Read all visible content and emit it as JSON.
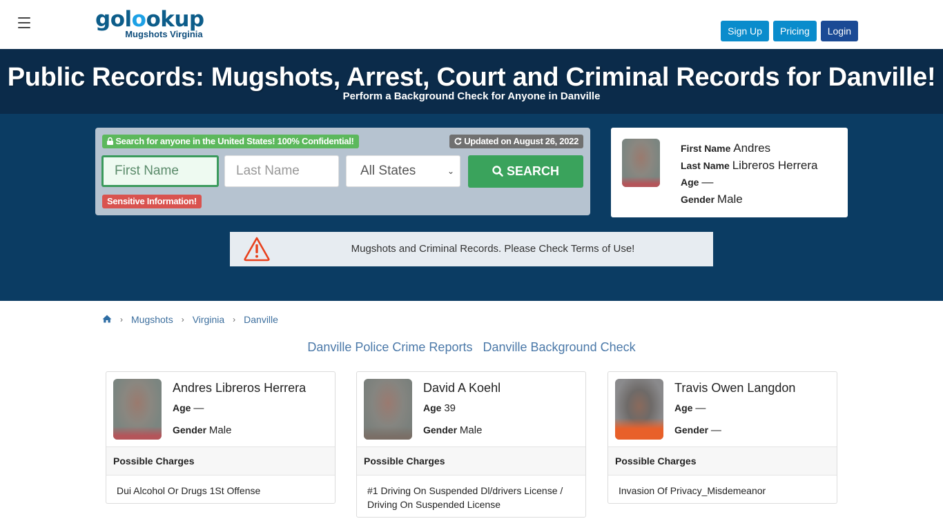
{
  "header": {
    "menu_icon": "hamburger-icon",
    "logo": {
      "brand_part1": "gol",
      "brand_accent": "o",
      "brand_part2": "okup",
      "subtitle": "Mugshots Virginia"
    },
    "buttons": {
      "signup": "Sign Up",
      "pricing": "Pricing",
      "login": "Login"
    }
  },
  "hero": {
    "title": "Public Records: Mugshots, Arrest, Court and Criminal Records for Danville!",
    "subtitle": "Perform a Background Check for Anyone in Danville"
  },
  "search": {
    "confidential_badge": "Search for anyone in the United States! 100% Confidential!",
    "confidential_icon": "lock-icon",
    "updated_badge": "Updated on August 26, 2022",
    "updated_icon": "refresh-icon",
    "first_name_placeholder": "First Name",
    "last_name_placeholder": "Last Name",
    "state_selected": "All States",
    "search_button": "SEARCH",
    "search_icon": "search-icon",
    "sensitive_badge": "Sensitive Information!"
  },
  "profile": {
    "first_name_label": "First Name",
    "first_name": "Andres",
    "last_name_label": "Last Name",
    "last_name": "Libreros Herrera",
    "age_label": "Age",
    "age": "—",
    "gender_label": "Gender",
    "gender": "Male"
  },
  "alert": {
    "icon": "warning-icon",
    "text": "Mugshots and Criminal Records. Please Check Terms of Use!",
    "color": "#e8401c"
  },
  "breadcrumb": {
    "home_icon": "home-icon",
    "items": [
      "Mugshots",
      "Virginia",
      "Danville"
    ]
  },
  "links": [
    "Danville Police Crime Reports",
    "Danville Background Check"
  ],
  "cards": [
    {
      "name": "Andres Libreros Herrera",
      "age_label": "Age",
      "age": "—",
      "gender_label": "Gender",
      "gender": "Male",
      "charges_label": "Possible Charges",
      "charges": "Dui Alcohol Or Drugs 1St Offense"
    },
    {
      "name": "David A Koehl",
      "age_label": "Age",
      "age": "39",
      "gender_label": "Gender",
      "gender": "Male",
      "charges_label": "Possible Charges",
      "charges": "#1 Driving On Suspended Dl/drivers License / Driving On Suspended License"
    },
    {
      "name": "Travis Owen Langdon",
      "age_label": "Age",
      "age": "—",
      "gender_label": "Gender",
      "gender": "—",
      "charges_label": "Possible Charges",
      "charges": "Invasion Of Privacy_Misdemeanor"
    }
  ],
  "colors": {
    "hero_dark": "#0b2b4a",
    "hero_body": "#0b3c63",
    "primary_button": "#0a8ccc",
    "login_button": "#1b4a95",
    "search_button": "#3aa35c",
    "link": "#4a78a8"
  }
}
